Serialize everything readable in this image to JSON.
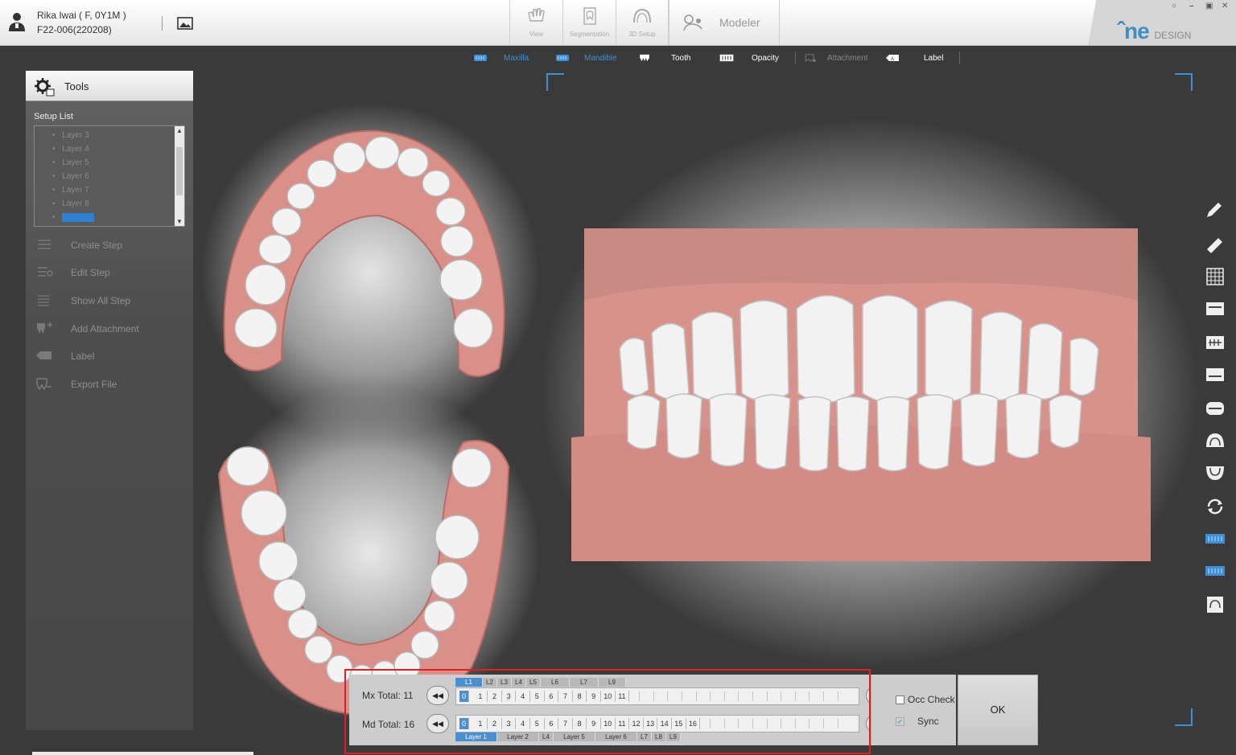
{
  "patient": {
    "name": "Rika Iwai ( F, 0Y1M )",
    "case_id": "F22-006(220208)"
  },
  "modes": [
    {
      "label": "View"
    },
    {
      "label": "Segmentation"
    },
    {
      "label": "3D Setup"
    },
    {
      "label": "Modeler"
    }
  ],
  "brand": {
    "logo": "ne",
    "logo_suffix": "DESIGN",
    "accent": "#3f8fc2"
  },
  "window_controls": {
    "minimize": "–",
    "restore": "▣",
    "close": "✕",
    "extra": "○"
  },
  "display_toolbar": {
    "maxilla": "Maxilla",
    "mandible": "Mandible",
    "tooth": "Tooth",
    "opacity": "Opacity",
    "attachment": "Attachment",
    "label": "Label"
  },
  "tools": {
    "title": "Tools",
    "setup_list_label": "Setup List",
    "layers": [
      "Layer 3",
      "Layer 4",
      "Layer 5",
      "Layer 6",
      "Layer 7",
      "Layer 8",
      "Layer 9"
    ],
    "selected_layer": "Layer 9",
    "items": [
      {
        "label": "Create Step",
        "icon": "list-icon"
      },
      {
        "label": "Edit Step",
        "icon": "edit-list-icon"
      },
      {
        "label": "Show All Step",
        "icon": "all-steps-icon"
      },
      {
        "label": "Add Attachment",
        "icon": "tooth-attachment-icon"
      },
      {
        "label": "Label",
        "icon": "label-icon"
      },
      {
        "label": "Export File",
        "icon": "export-tooth-icon"
      }
    ]
  },
  "right_tools": [
    "pencil-icon",
    "ruler-icon",
    "grid-icon",
    "upper-arch-icon",
    "arch-front-icon",
    "lower-arch-icon",
    "bite-icon",
    "upper-jaw-icon",
    "lower-jaw-icon",
    "rotate-icon",
    "maxilla-blue-icon",
    "mandible-blue-icon",
    "jaw-record-icon"
  ],
  "timeline": {
    "mx_label": "Mx Total: 11",
    "md_label": "Md Total: 16",
    "mx_steps": [
      "0",
      "1",
      "2",
      "3",
      "4",
      "5",
      "6",
      "7",
      "8",
      "9",
      "10",
      "11"
    ],
    "md_steps": [
      "0",
      "1",
      "2",
      "3",
      "4",
      "5",
      "6",
      "7",
      "8",
      "9",
      "10",
      "11",
      "12",
      "13",
      "14",
      "15",
      "16"
    ],
    "mx_layers": [
      "L1",
      "L2",
      "L3",
      "L4",
      "L5",
      "L6",
      "L7",
      "L9"
    ],
    "md_layers": [
      "Layer 1",
      "Layer 2",
      "L4",
      "Layer 5",
      "Layer 6",
      "L7",
      "L8",
      "L9"
    ],
    "prev_label": "◀◀",
    "next_label": "▶▶"
  },
  "options": {
    "occ_check": "Occ Check",
    "occ_check_on": false,
    "sync": "Sync",
    "sync_on": true
  },
  "ok_label": "OK",
  "colors": {
    "selection_blue": "#2f7fd2",
    "gum": "#dc928a",
    "tooth": "#f1f1f1",
    "highlight_red": "#e02020"
  }
}
